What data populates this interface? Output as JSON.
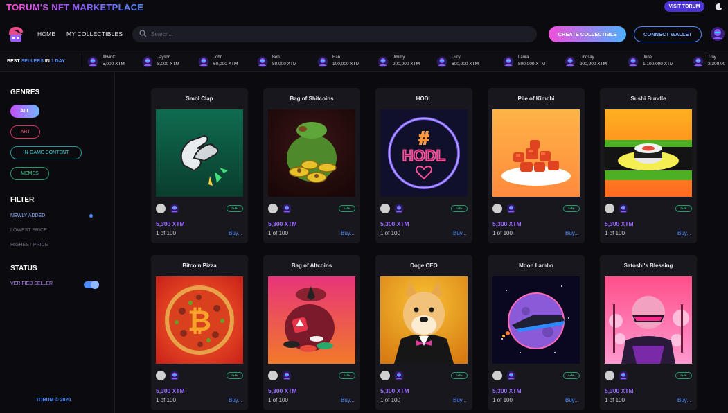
{
  "brand": "TORUM'S NFT MARKETPLACE",
  "visit_label": "VISIT TORUM",
  "nav": {
    "home": "HOME",
    "collectibles": "MY COLLECTIBLES",
    "search_placeholder": "Search...",
    "create": "CREATE COLLECTIBLE",
    "connect": "CONNECT WALLET"
  },
  "sellers": {
    "title_prefix": "BEST ",
    "title_highlight": "SELLERS",
    "title_mid": " IN ",
    "title_period": "1 DAY",
    "items": [
      {
        "name": "AlwinC",
        "amount": "5,000 XTM"
      },
      {
        "name": "Jayson",
        "amount": "8,000 XTM"
      },
      {
        "name": "John",
        "amount": "60,000 XTM"
      },
      {
        "name": "Bob",
        "amount": "80,000 XTM"
      },
      {
        "name": "Han",
        "amount": "100,000 XTM"
      },
      {
        "name": "Jimmy",
        "amount": "200,000 XTM"
      },
      {
        "name": "Lucy",
        "amount": "600,000 XTM"
      },
      {
        "name": "Laura",
        "amount": "800,000 XTM"
      },
      {
        "name": "Lindsay",
        "amount": "900,000 XTM"
      },
      {
        "name": "June",
        "amount": "1,100,000 XTM"
      },
      {
        "name": "Troy",
        "amount": "2,300,00"
      }
    ]
  },
  "sidebar": {
    "genres_title": "GENRES",
    "genres": [
      "ALL",
      "ART",
      "IN-GAME CONTENT",
      "MEMES"
    ],
    "filter_title": "FILTER",
    "filters": [
      "NEWLY ADDED",
      "LOWEST PRICE",
      "HIGHEST PRICE"
    ],
    "status_title": "STATUS",
    "status_item": "VERIFIED SELLER",
    "footer": "TORUM © 2020"
  },
  "cards": [
    {
      "title": "Smol Clap",
      "badge": "GIF",
      "price": "5,300 XTM",
      "edition": "1 of 100",
      "buy": "Buy..."
    },
    {
      "title": "Bag of Shitcoins",
      "badge": "GIF",
      "price": "5,300 XTM",
      "edition": "1 of 100",
      "buy": "Buy..."
    },
    {
      "title": "HODL",
      "badge": "GIF",
      "price": "5,300 XTM",
      "edition": "1 of 100",
      "buy": "Buy...",
      "art_text": "HODL",
      "art_hash": "#"
    },
    {
      "title": "Pile of Kimchi",
      "badge": "GIF",
      "price": "5,300 XTM",
      "edition": "1 of 100",
      "buy": "Buy..."
    },
    {
      "title": "Sushi Bundle",
      "badge": "GIF",
      "price": "5,300 XTM",
      "edition": "1 of 100",
      "buy": "Buy..."
    },
    {
      "title": "Bitcoin Pizza",
      "badge": "GIF",
      "price": "5,300 XTM",
      "edition": "1 of 100",
      "buy": "Buy..."
    },
    {
      "title": "Bag of Altcoins",
      "badge": "GIF",
      "price": "5,300 XTM",
      "edition": "1 of 100",
      "buy": "Buy..."
    },
    {
      "title": "Doge CEO",
      "badge": "GIF",
      "price": "5,300 XTM",
      "edition": "1 of 100",
      "buy": "Buy..."
    },
    {
      "title": "Moon Lambo",
      "badge": "GIF",
      "price": "5,300 XTM",
      "edition": "1 of 100",
      "buy": "Buy..."
    },
    {
      "title": "Satoshi's Blessing",
      "badge": "GIF",
      "price": "5,300 XTM",
      "edition": "1 of 100",
      "buy": "Buy..."
    }
  ],
  "colors": {
    "accent_blue": "#4f8bff",
    "accent_purple": "#9b6cff",
    "accent_pink": "#f04fd9",
    "badge_green": "#3fd191"
  }
}
